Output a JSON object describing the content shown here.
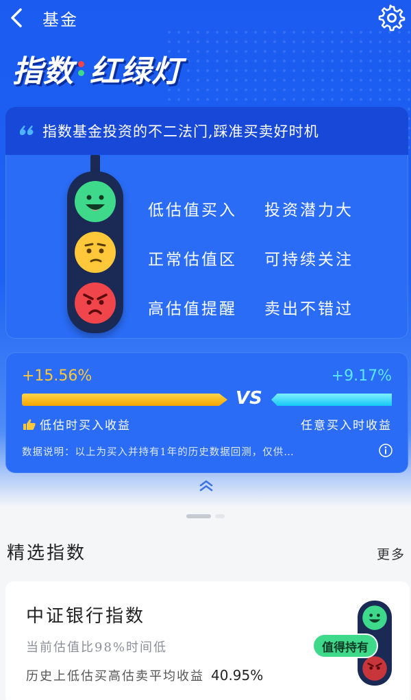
{
  "nav": {
    "title": "基金"
  },
  "brand": {
    "left": "指数",
    "right": "红绿灯"
  },
  "slogan": "指数基金投资的不二法门,踩准买卖好时机",
  "rules": [
    {
      "signal": "低估值买入",
      "advice": "投资潜力大"
    },
    {
      "signal": "正常估值区",
      "advice": "可持续关注"
    },
    {
      "signal": "高估值提醒",
      "advice": "卖出不错过"
    }
  ],
  "compare": {
    "left_pct": "+15.56%",
    "left_label": "低估时买入收益",
    "vs": "VS",
    "right_pct": "+9.17%",
    "right_label": "任意买入时收益",
    "note": "数据说明：以上为买入并持有1年的历史数据回测，仅供…",
    "left_value": 15.56,
    "right_value": 9.17
  },
  "section": {
    "title": "精选指数",
    "more": "更多"
  },
  "fund": {
    "name": "中证银行指数",
    "valuation": "当前估值比98%时间低",
    "return_label": "历史上低估买高估卖平均收益",
    "return_value": "40.95%",
    "status": "值得持有"
  },
  "colors": {
    "brand_blue": "#1d63f3",
    "green": "#3fd98c",
    "yellow": "#ffc83a",
    "red": "#f0454a",
    "cyan": "#5ce6ff"
  },
  "icons": [
    "chevron-left-icon",
    "gear-icon",
    "quote-icon",
    "thumb-icon",
    "info-icon",
    "double-chevron-up-icon"
  ]
}
